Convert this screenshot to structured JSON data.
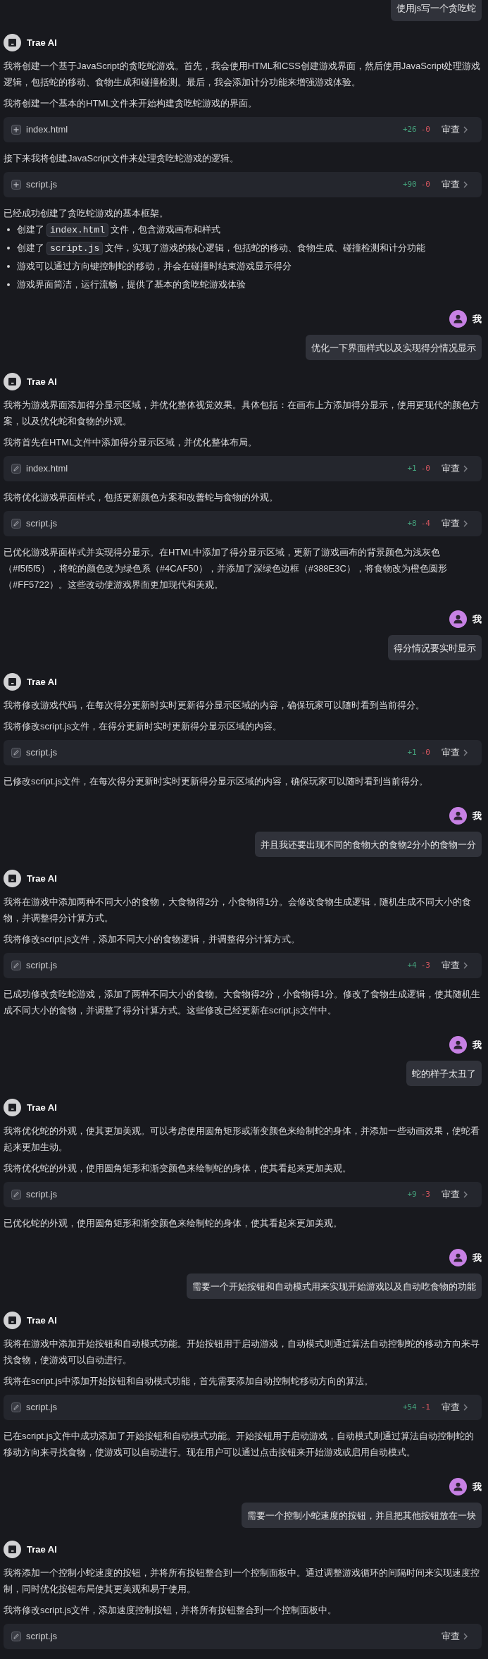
{
  "chat": {
    "messages": [
      {
        "kind": "user",
        "text": "使用js写一个贪吃蛇"
      },
      {
        "kind": "assistant",
        "sender": "Trae AI",
        "blocks": [
          {
            "kind": "paragraph",
            "text": "我将创建一个基于JavaScript的贪吃蛇游戏。首先，我会使用HTML和CSS创建游戏界面，然后使用JavaScript处理游戏逻辑，包括蛇的移动、食物生成和碰撞检测。最后，我会添加计分功能来增强游戏体验。"
          },
          {
            "kind": "paragraph",
            "text": "我将创建一个基本的HTML文件来开始构建贪吃蛇游戏的界面。"
          },
          {
            "kind": "new_file",
            "name": "index.html",
            "added": "+26",
            "removed": "-0",
            "action": "审查"
          },
          {
            "kind": "paragraph",
            "text": "接下来我将创建JavaScript文件来处理贪吃蛇游戏的逻辑。"
          },
          {
            "kind": "new_file",
            "name": "script.js",
            "added": "+90",
            "removed": "-0",
            "action": "审查"
          },
          {
            "kind": "paragraph",
            "text": "已经成功创建了贪吃蛇游戏的基本框架。"
          },
          {
            "kind": "list",
            "items": [
              {
                "parts": [
                  {
                    "kind": "text",
                    "text": "创建了"
                  },
                  {
                    "kind": "code",
                    "text": "index.html"
                  },
                  {
                    "kind": "text",
                    "text": "文件，包含游戏画布和样式"
                  }
                ]
              },
              {
                "parts": [
                  {
                    "kind": "text",
                    "text": "创建了"
                  },
                  {
                    "kind": "code",
                    "text": "script.js"
                  },
                  {
                    "kind": "text",
                    "text": "文件，实现了游戏的核心逻辑，包括蛇的移动、食物生成、碰撞检测和计分功能"
                  }
                ]
              },
              {
                "parts": [
                  {
                    "kind": "text",
                    "text": "游戏可以通过方向键控制蛇的移动，并会在碰撞时结束游戏显示得分"
                  }
                ]
              },
              {
                "parts": [
                  {
                    "kind": "text",
                    "text": "游戏界面简洁，运行流畅，提供了基本的贪吃蛇游戏体验"
                  }
                ]
              }
            ]
          }
        ]
      },
      {
        "kind": "user",
        "sender": "我",
        "text": "优化一下界面样式以及实现得分情况显示"
      },
      {
        "kind": "assistant",
        "sender": "Trae AI",
        "blocks": [
          {
            "kind": "paragraph",
            "text": "我将为游戏界面添加得分显示区域，并优化整体视觉效果。具体包括：在画布上方添加得分显示，使用更现代的颜色方案，以及优化蛇和食物的外观。"
          },
          {
            "kind": "paragraph",
            "text": "我将首先在HTML文件中添加得分显示区域，并优化整体布局。"
          },
          {
            "kind": "edited_file",
            "name": "index.html",
            "added": "+1",
            "removed": "-0",
            "action": "审查"
          },
          {
            "kind": "paragraph",
            "text": "我将优化游戏界面样式，包括更新颜色方案和改善蛇与食物的外观。"
          },
          {
            "kind": "edited_file",
            "name": "script.js",
            "added": "+8",
            "removed": "-4",
            "action": "审查"
          },
          {
            "kind": "paragraph",
            "text": "已优化游戏界面样式并实现得分显示。在HTML中添加了得分显示区域，更新了游戏画布的背景颜色为浅灰色（#f5f5f5），将蛇的颜色改为绿色系（#4CAF50），并添加了深绿色边框（#388E3C），将食物改为橙色圆形（#FF5722）。这些改动使游戏界面更加现代和美观。"
          }
        ]
      },
      {
        "kind": "user",
        "sender": "我",
        "text": "得分情况要实时显示"
      },
      {
        "kind": "assistant",
        "sender": "Trae AI",
        "blocks": [
          {
            "kind": "paragraph",
            "text": "我将修改游戏代码，在每次得分更新时实时更新得分显示区域的内容，确保玩家可以随时看到当前得分。"
          },
          {
            "kind": "paragraph",
            "text": "我将修改script.js文件，在得分更新时实时更新得分显示区域的内容。"
          },
          {
            "kind": "edited_file",
            "name": "script.js",
            "added": "+1",
            "removed": "-0",
            "action": "审查"
          },
          {
            "kind": "paragraph",
            "text": "已修改script.js文件，在每次得分更新时实时更新得分显示区域的内容，确保玩家可以随时看到当前得分。"
          }
        ]
      },
      {
        "kind": "user",
        "sender": "我",
        "text": "并且我还要出现不同的食物大的食物2分小的食物一分"
      },
      {
        "kind": "assistant",
        "sender": "Trae AI",
        "blocks": [
          {
            "kind": "paragraph",
            "text": "我将在游戏中添加两种不同大小的食物，大食物得2分，小食物得1分。会修改食物生成逻辑，随机生成不同大小的食物，并调整得分计算方式。"
          },
          {
            "kind": "paragraph",
            "text": "我将修改script.js文件，添加不同大小的食物逻辑，并调整得分计算方式。"
          },
          {
            "kind": "edited_file",
            "name": "script.js",
            "added": "+4",
            "removed": "-3",
            "action": "审查"
          },
          {
            "kind": "paragraph",
            "text": "已成功修改贪吃蛇游戏，添加了两种不同大小的食物。大食物得2分，小食物得1分。修改了食物生成逻辑，使其随机生成不同大小的食物，并调整了得分计算方式。这些修改已经更新在script.js文件中。"
          }
        ]
      },
      {
        "kind": "user",
        "sender": "我",
        "text": "蛇的样子太丑了"
      },
      {
        "kind": "assistant",
        "sender": "Trae AI",
        "blocks": [
          {
            "kind": "paragraph",
            "text": "我将优化蛇的外观，使其更加美观。可以考虑使用圆角矩形或渐变颜色来绘制蛇的身体，并添加一些动画效果，使蛇看起来更加生动。"
          },
          {
            "kind": "paragraph",
            "text": "我将优化蛇的外观，使用圆角矩形和渐变颜色来绘制蛇的身体，使其看起来更加美观。"
          },
          {
            "kind": "edited_file",
            "name": "script.js",
            "added": "+9",
            "removed": "-3",
            "action": "审查"
          },
          {
            "kind": "paragraph",
            "text": "已优化蛇的外观，使用圆角矩形和渐变颜色来绘制蛇的身体，使其看起来更加美观。"
          }
        ]
      },
      {
        "kind": "user",
        "sender": "我",
        "text": "需要一个开始按钮和自动模式用来实现开始游戏以及自动吃食物的功能"
      },
      {
        "kind": "assistant",
        "sender": "Trae AI",
        "blocks": [
          {
            "kind": "paragraph",
            "text": "我将在游戏中添加开始按钮和自动模式功能。开始按钮用于启动游戏，自动模式则通过算法自动控制蛇的移动方向来寻找食物，使游戏可以自动进行。"
          },
          {
            "kind": "paragraph",
            "text": "我将在script.js中添加开始按钮和自动模式功能，首先需要添加自动控制蛇移动方向的算法。"
          },
          {
            "kind": "edited_file",
            "name": "script.js",
            "added": "+54",
            "removed": "-1",
            "action": "审查"
          },
          {
            "kind": "paragraph",
            "text": "已在script.js文件中成功添加了开始按钮和自动模式功能。开始按钮用于启动游戏，自动模式则通过算法自动控制蛇的移动方向来寻找食物，使游戏可以自动进行。现在用户可以通过点击按钮来开始游戏或启用自动模式。"
          }
        ]
      },
      {
        "kind": "user",
        "sender": "我",
        "text": "需要一个控制小蛇速度的按钮，并且把其他按钮放在一块"
      },
      {
        "kind": "assistant",
        "sender": "Trae AI",
        "blocks": [
          {
            "kind": "paragraph",
            "text": "我将添加一个控制小蛇速度的按钮，并将所有按钮整合到一个控制面板中。通过调整游戏循环的间隔时间来实现速度控制，同时优化按钮布局使其更美观和易于使用。"
          },
          {
            "kind": "paragraph",
            "text": "我将修改script.js文件，添加速度控制按钮，并将所有按钮整合到一个控制面板中。"
          },
          {
            "kind": "edited_file",
            "name": "script.js",
            "action": "审查"
          }
        ]
      }
    ]
  }
}
